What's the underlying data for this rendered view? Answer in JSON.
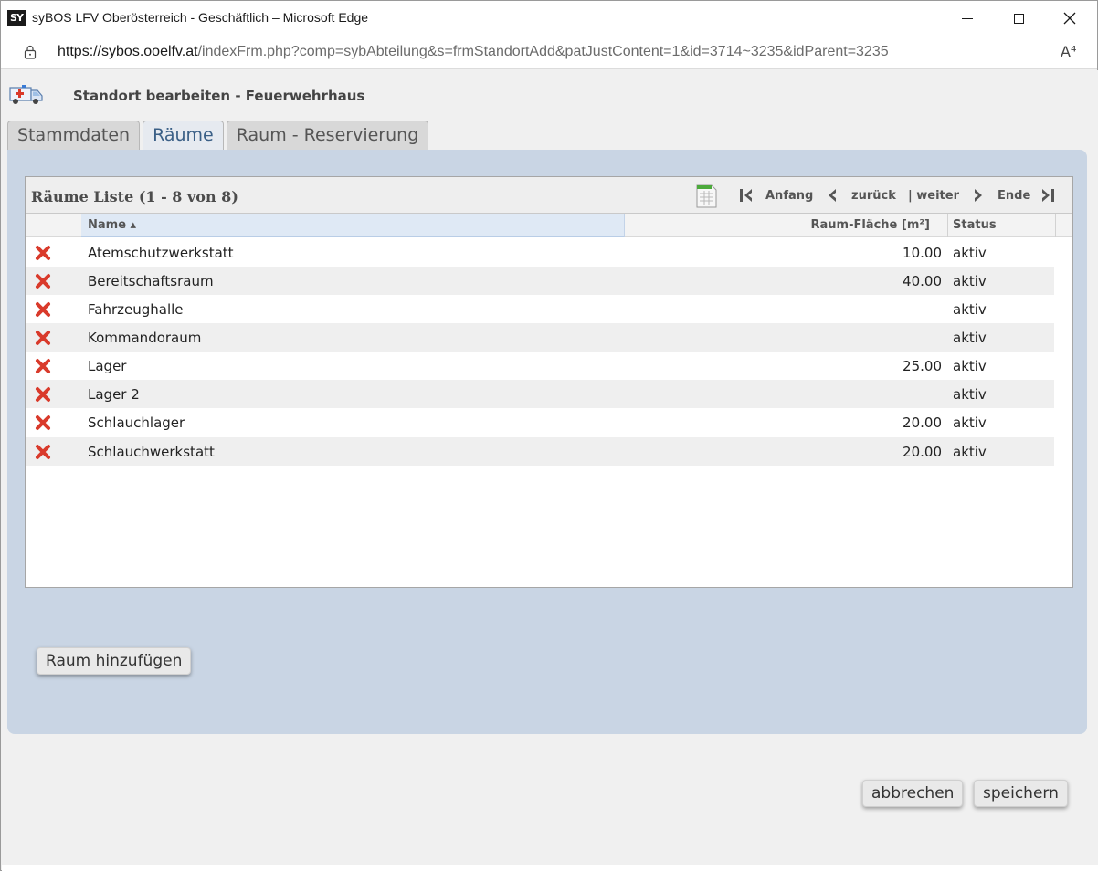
{
  "window": {
    "title": "syBOS LFV Oberösterreich - Geschäftlich – Microsoft Edge",
    "logo_text": "SY",
    "url_host": "https://sybos.ooelfv.at",
    "url_rest": "/indexFrm.php?comp=sybAbteilung&s=frmStandortAdd&patJustContent=1&id=3714~3235&idParent=3235",
    "read_aloud": "A⁴"
  },
  "page": {
    "title": "Standort bearbeiten - Feuerwehrhaus",
    "icon": "ambulance-icon"
  },
  "tabs": [
    {
      "label": "Stammdaten",
      "active": false
    },
    {
      "label": "Räume",
      "active": true
    },
    {
      "label": "Raum - Reservierung",
      "active": false
    }
  ],
  "list": {
    "title": "Räume Liste (1 - 8 von 8)",
    "nav": {
      "first": "Anfang",
      "prev": "zurück",
      "next": "| weiter",
      "last": "Ende"
    },
    "columns": {
      "name": "Name ▴",
      "area": "Raum-Fläche [m²]",
      "status": "Status"
    },
    "rows": [
      {
        "name": "Atemschutzwerkstatt",
        "area": "10.00",
        "status": "aktiv"
      },
      {
        "name": "Bereitschaftsraum",
        "area": "40.00",
        "status": "aktiv"
      },
      {
        "name": "Fahrzeughalle",
        "area": "",
        "status": "aktiv"
      },
      {
        "name": "Kommandoraum",
        "area": "",
        "status": "aktiv"
      },
      {
        "name": "Lager",
        "area": "25.00",
        "status": "aktiv"
      },
      {
        "name": "Lager 2",
        "area": "",
        "status": "aktiv"
      },
      {
        "name": "Schlauchlager",
        "area": "20.00",
        "status": "aktiv"
      },
      {
        "name": "Schlauchwerkstatt",
        "area": "20.00",
        "status": "aktiv"
      }
    ]
  },
  "buttons": {
    "add_room": "Raum hinzufügen",
    "cancel": "abbrechen",
    "save": "speichern"
  },
  "colors": {
    "panel": "#c9d5e4",
    "delete": "#d93a2b",
    "active_tab_text": "#3a5f86"
  }
}
